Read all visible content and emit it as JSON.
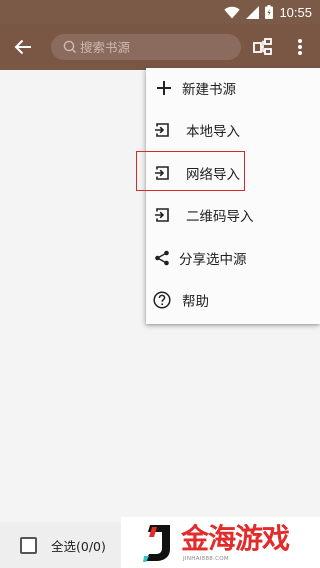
{
  "status_bar": {
    "time": "10:55"
  },
  "toolbar": {
    "search_placeholder": "搜索书源"
  },
  "menu": {
    "items": [
      {
        "label": "新建书源",
        "icon": "plus-icon"
      },
      {
        "label": "本地导入",
        "icon": "import-icon"
      },
      {
        "label": "网络导入",
        "icon": "import-icon"
      },
      {
        "label": "二维码导入",
        "icon": "import-icon"
      },
      {
        "label": "分享选中源",
        "icon": "share-icon"
      },
      {
        "label": "帮助",
        "icon": "help-icon"
      }
    ],
    "highlighted": "网络导入"
  },
  "bottom_bar": {
    "select_all_label": "全选(0/0)"
  },
  "watermark": {
    "title": "金海游戏",
    "url": "JINHAI888.COM"
  },
  "colors": {
    "toolbar": "#7a5645",
    "status_bar": "#7b5a48",
    "background": "#f5f4f4",
    "highlight_border": "#d42a2a",
    "watermark_red": "#e22b2b"
  }
}
